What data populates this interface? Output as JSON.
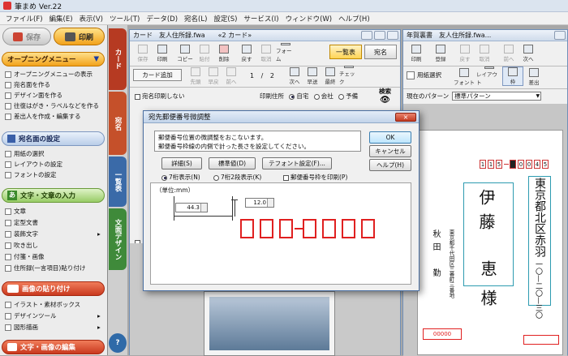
{
  "app": {
    "title": "筆まめ Ver.22"
  },
  "menu": [
    "ファイル(F)",
    "編集(E)",
    "表示(V)",
    "ツール(T)",
    "データ(D)",
    "宛名(L)",
    "設定(S)",
    "サービス(I)",
    "ウィンドウ(W)",
    "ヘルプ(H)"
  ],
  "sidebar": {
    "save_label": "保存",
    "print_label": "印刷",
    "opening": {
      "title": "オープニングメニュー",
      "items": [
        "オープニングメニューの表示",
        "宛名面を作る",
        "デザイン面を作る",
        "往復はがき・ラベルなどを作る",
        "差出人を作成・編集する"
      ]
    },
    "address": {
      "title": "宛名面の設定",
      "items": [
        "用紙の選択",
        "レイアウトの設定",
        "フォントの設定"
      ]
    },
    "text": {
      "title": "文字・文章の入力",
      "items": [
        "文章",
        "定型文書",
        "装飾文字",
        "吹き出し",
        "付箋・画像",
        "住所録(一言項目)貼り付け"
      ]
    },
    "image": {
      "title": "画像の貼り付け",
      "items": [
        "イラスト・素材ボックス",
        "デザインツール",
        "図形描画"
      ]
    },
    "edit": {
      "title": "文字・画像の編集"
    }
  },
  "vtabs": [
    "カード",
    "宛名",
    "一覧表",
    "文面デザイン"
  ],
  "card_window": {
    "title": "カード　友人住所録.fwa　　«2 カード»",
    "tools": [
      "保存",
      "印刷",
      "コピー",
      "貼付",
      "削除",
      "戻す",
      "取消",
      "フォーム"
    ],
    "list_label": "一覧表",
    "address_label": "宛名",
    "add_card": "カード追加",
    "nav": [
      "先頭",
      "早戻",
      "前へ"
    ],
    "page_current": "1",
    "page_sep": "/",
    "page_total": "2",
    "nav2": [
      "次へ",
      "早送",
      "最終",
      "チェック"
    ],
    "no_print": "宛名印刷しない",
    "print_addr_label": "印刷住所",
    "addr_options": [
      "自宅",
      "会社",
      "予備"
    ],
    "search_label": "検索"
  },
  "postcard_window": {
    "title": "年賀裏書　友人住所録.fwa...",
    "tools": [
      "印刷",
      "登録",
      "戻す",
      "取消",
      "前へ",
      "次へ"
    ],
    "paper_select": "用紙選択",
    "tools2": [
      "フォント",
      "レイアウト",
      "枠",
      "差出"
    ],
    "pattern_label": "現在のパターン",
    "pattern_value": "標準パターン"
  },
  "postcard": {
    "zip_digits": [
      "1",
      "1",
      "5",
      "",
      "0",
      "0",
      "4",
      "5"
    ],
    "recipient_addr": "東京都北区赤羽",
    "recipient_num": "一〇—二〇—三〇",
    "recipient_name1": "伊藤",
    "recipient_name2": "恵",
    "honorific": "様",
    "sender_name": "秋田　勤",
    "sender_addr": "東京都千代田区三番町三番地",
    "stamp_note": "00000"
  },
  "dialog": {
    "title": "宛先郵便番号微調整",
    "close": "×",
    "desc_line1": "郵便番号位置の微調整をおこないます。",
    "desc_line2": "郵便番号枠線の内側で計った長さを設定してください。",
    "ok": "OK",
    "cancel": "キャンセル",
    "help": "ヘルプ(H)",
    "detail": "詳細(S)",
    "standard": "標準値(D)",
    "template": "テフォント設定(F)...",
    "radio_7": "7桁表示(N)",
    "radio_72": "7桁2段表示(K)",
    "print_frame": "郵便番号枠を印刷(P)",
    "unit": "（単位:mm）",
    "left_value": "44.3",
    "top_value": "12.0"
  }
}
